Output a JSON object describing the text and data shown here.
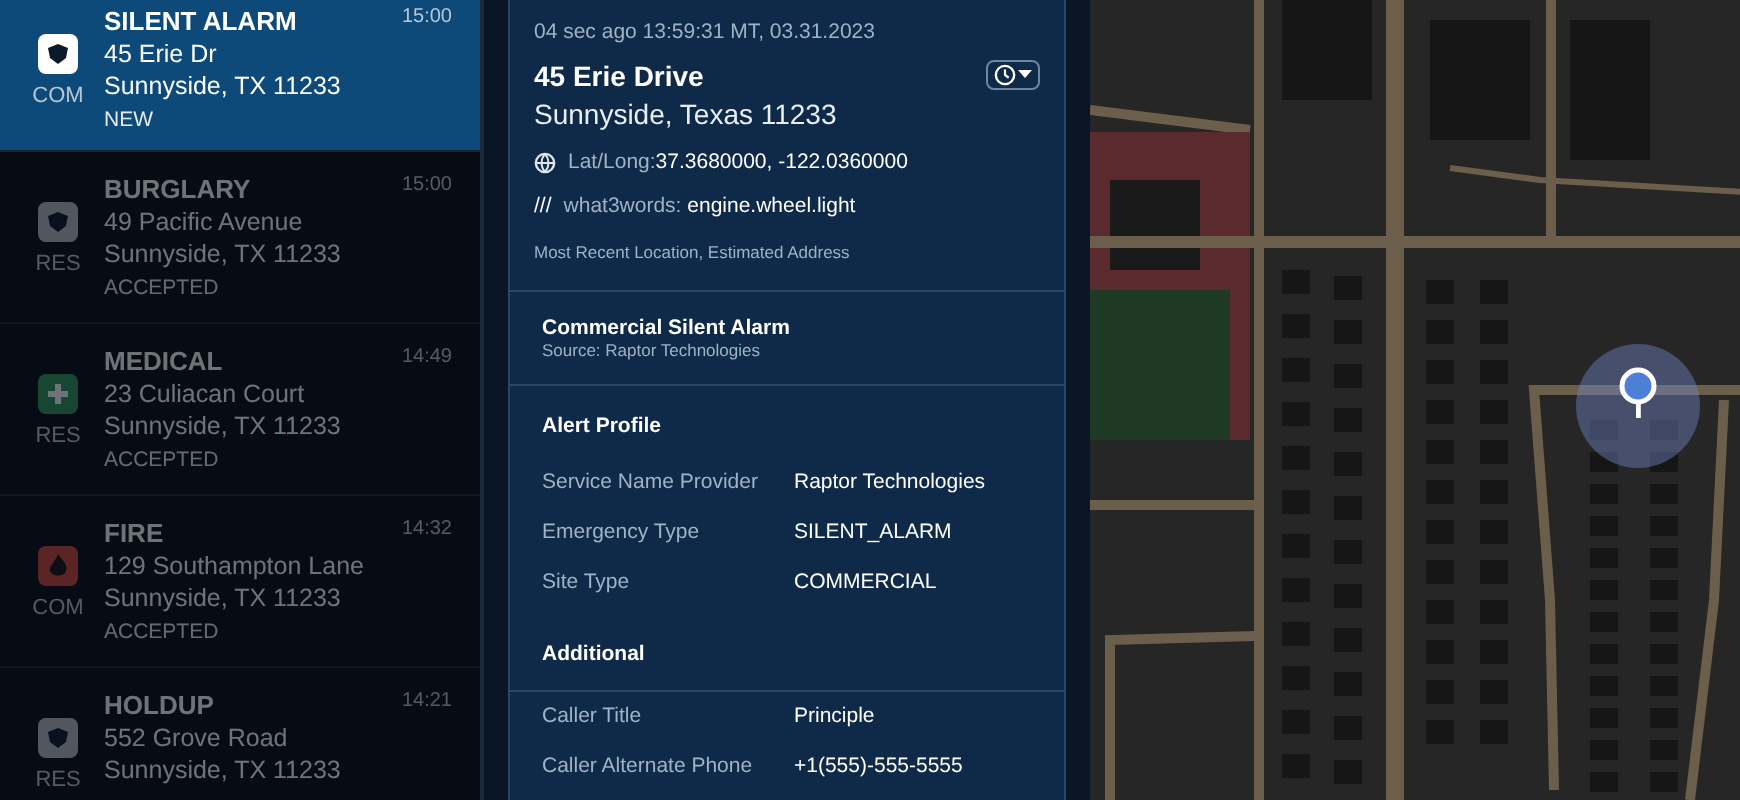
{
  "incidents": [
    {
      "kind": "police",
      "title": "SILENT ALARM",
      "time": "15:00",
      "street": "45 Erie Dr",
      "city": "Sunnyside, TX 11233",
      "site": "COM",
      "status": "NEW",
      "selected": true
    },
    {
      "kind": "police",
      "title": "BURGLARY",
      "time": "15:00",
      "street": "49 Pacific Avenue",
      "city": "Sunnyside, TX 11233",
      "site": "RES",
      "status": "ACCEPTED",
      "selected": false
    },
    {
      "kind": "medical",
      "title": "MEDICAL",
      "time": "14:49",
      "street": "23 Culiacan Court",
      "city": "Sunnyside, TX 11233",
      "site": "RES",
      "status": "ACCEPTED",
      "selected": false
    },
    {
      "kind": "fire",
      "title": "FIRE",
      "time": "14:32",
      "street": "129 Southampton Lane",
      "city": "Sunnyside, TX 11233",
      "site": "COM",
      "status": "ACCEPTED",
      "selected": false
    },
    {
      "kind": "police",
      "title": "HOLDUP",
      "time": "14:21",
      "street": "552 Grove Road",
      "city": "Sunnyside, TX 11233",
      "site": "RES",
      "selected": false
    }
  ],
  "detail": {
    "timestamp": "04 sec ago 13:59:31 MT, 03.31.2023",
    "street": "45 Erie Drive",
    "city": "Sunnyside, Texas 11233",
    "latlong_label": "Lat/Long:",
    "latlong_value": "37.3680000, -122.0360000",
    "w3w_mark": "///",
    "w3w_label": "what3words:",
    "w3w_value": "engine.wheel.light",
    "location_note": "Most Recent Location, Estimated Address",
    "alarm_title": "Commercial Silent Alarm",
    "alarm_source": "Source:  Raptor Technologies",
    "sections": [
      {
        "heading": "Alert Profile",
        "rows": [
          {
            "label": "Service Name Provider",
            "value": "Raptor Technologies"
          },
          {
            "label": "Emergency Type",
            "value": "SILENT_ALARM"
          },
          {
            "label": "Site Type",
            "value": "COMMERCIAL"
          }
        ]
      },
      {
        "heading": "Additional",
        "rows": [
          {
            "label": "Caller Title",
            "value": "Principle"
          },
          {
            "label": "Caller Alternate Phone",
            "value": "+1(555)-555-5555"
          }
        ]
      }
    ]
  }
}
